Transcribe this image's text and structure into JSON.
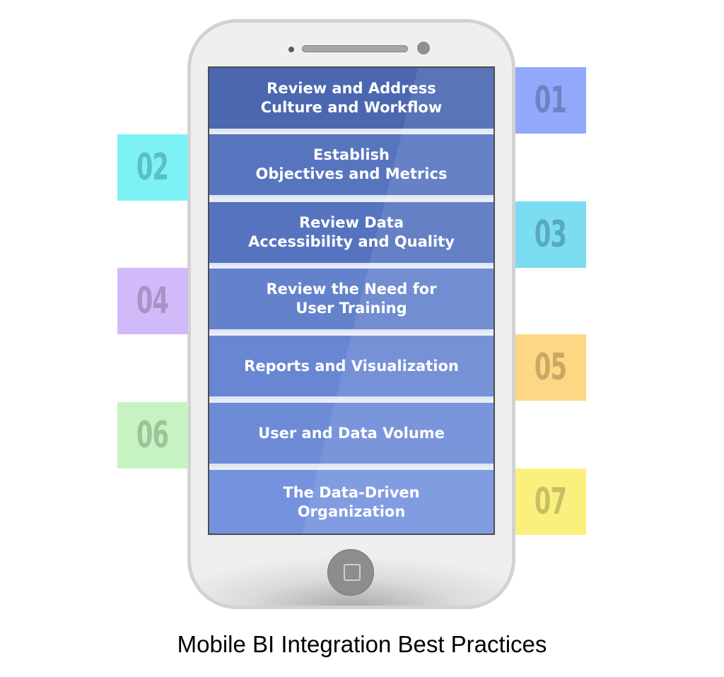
{
  "title": "Mobile BI Integration Best Practices",
  "steps": [
    {
      "number": "01",
      "line1": "Review and Address",
      "line2": "Culture and Workflow",
      "row_color": "#4a67b0",
      "tag_color": "#94a8fb",
      "number_color": "#6f82c4",
      "side": "right"
    },
    {
      "number": "02",
      "line1": "Establish",
      "line2": "Objectives and Metrics",
      "row_color": "#5775bf",
      "tag_color": "#7df2f5",
      "number_color": "#5bbfc4",
      "side": "left"
    },
    {
      "number": "03",
      "line1": "Review Data",
      "line2": "Accessibility and Quality",
      "row_color": "#5673bf",
      "tag_color": "#7cdcf2",
      "number_color": "#59a9be",
      "side": "right"
    },
    {
      "number": "04",
      "line1": "Review the Need for",
      "line2": "User Training",
      "row_color": "#6482cc",
      "tag_color": "#d1baf9",
      "number_color": "#a793c8",
      "side": "left"
    },
    {
      "number": "05",
      "line1": "Reports and Visualization",
      "line2": "",
      "row_color": "#6886d2",
      "tag_color": "#fdd783",
      "number_color": "#c8a866",
      "side": "right"
    },
    {
      "number": "06",
      "line1": "User and Data Volume",
      "line2": "",
      "row_color": "#6d8bd7",
      "tag_color": "#c7f3c3",
      "number_color": "#9dc39a",
      "side": "left"
    },
    {
      "number": "07",
      "line1": "The Data-Driven",
      "line2": "Organization",
      "row_color": "#7592de",
      "tag_color": "#faf07e",
      "number_color": "#c8bf63",
      "side": "right"
    }
  ]
}
